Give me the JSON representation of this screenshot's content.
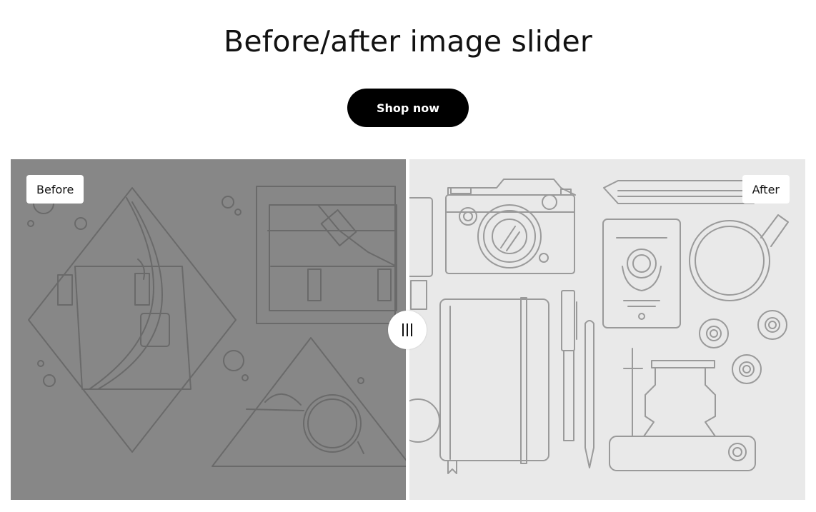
{
  "header": {
    "title": "Before/after image slider",
    "cta_label": "Shop now"
  },
  "slider": {
    "position_fraction": 0.5,
    "before_label": "Before",
    "after_label": "After",
    "handle_icon": "grip-lines-icon",
    "before_background": "#878787",
    "after_background": "#e9e9e9"
  }
}
